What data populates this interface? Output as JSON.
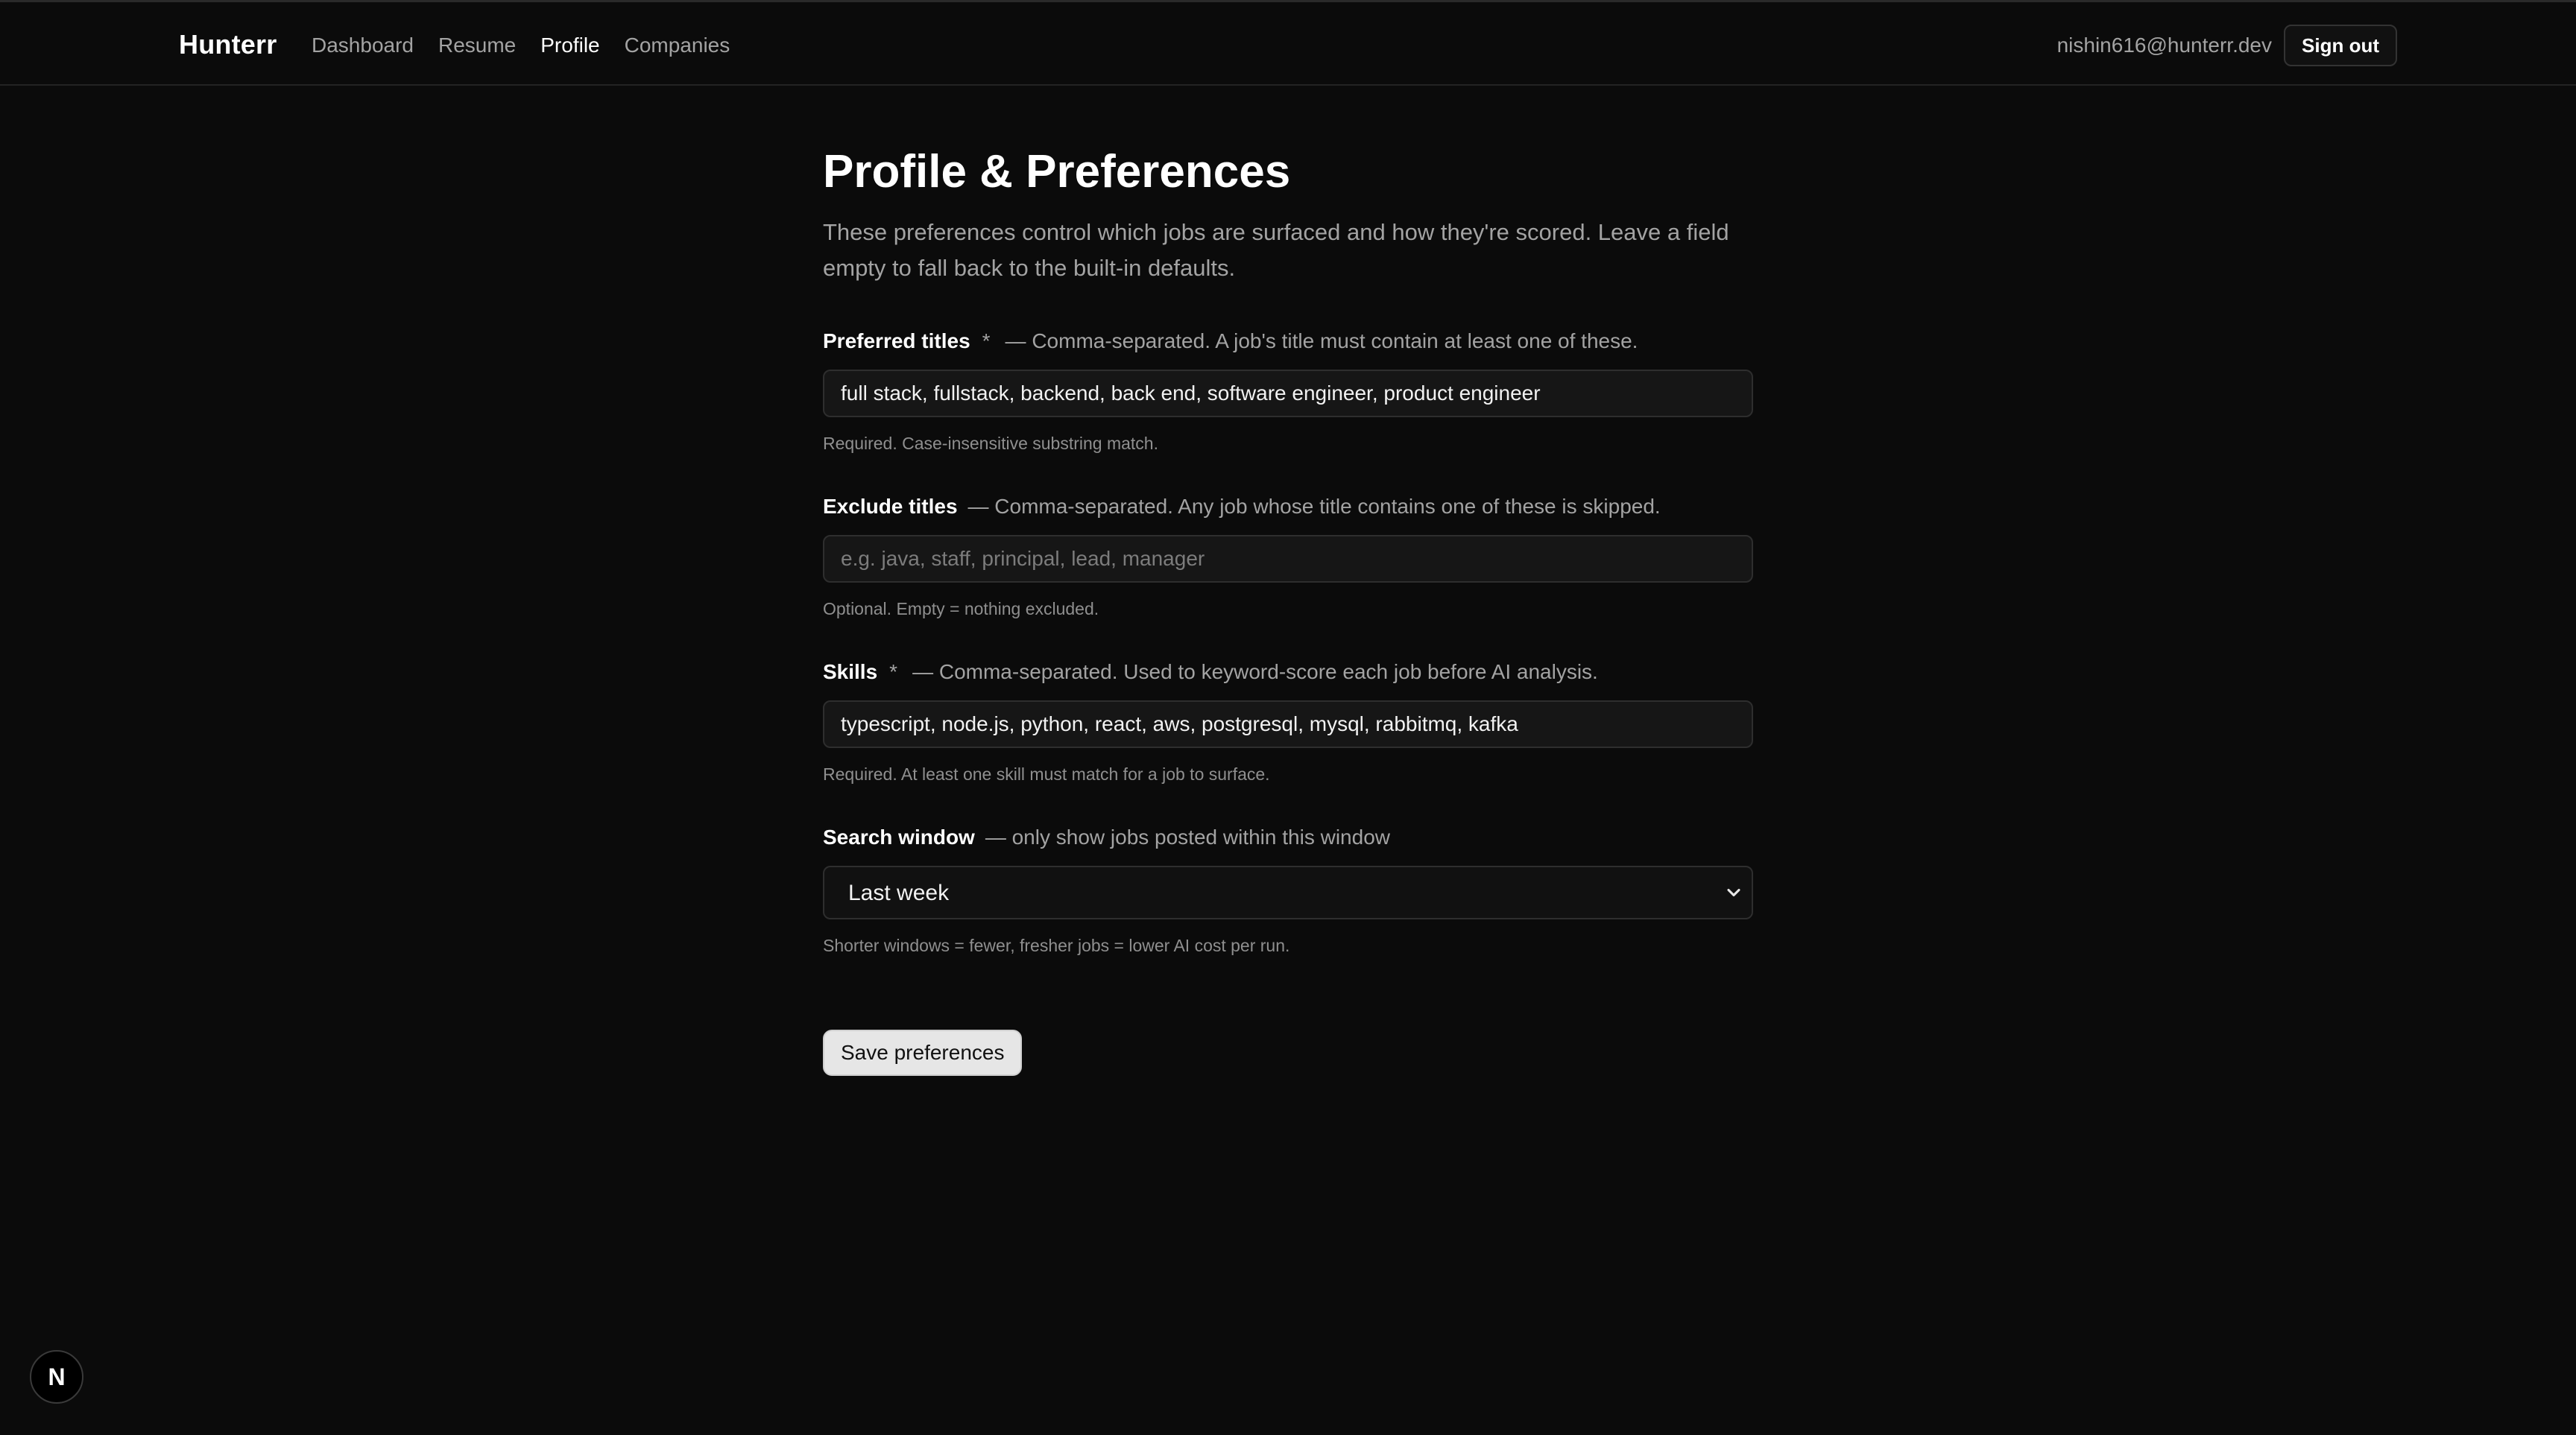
{
  "app": {
    "brand": "Hunterr",
    "nav": [
      {
        "label": "Dashboard",
        "active": false
      },
      {
        "label": "Resume",
        "active": false
      },
      {
        "label": "Profile",
        "active": true
      },
      {
        "label": "Companies",
        "active": false
      }
    ],
    "user_email": "nishin616@hunterr.dev",
    "sign_out_label": "Sign out"
  },
  "page": {
    "title": "Profile & Preferences",
    "subtitle": "These preferences control which jobs are surfaced and how they're scored. Leave a field empty to fall back to the built-in defaults."
  },
  "fields": {
    "preferred_titles": {
      "label": "Preferred titles",
      "required_mark": "*",
      "hint": "— Comma-separated. A job's title must contain at least one of these.",
      "value": "full stack, fullstack, backend, back end, software engineer, product engineer",
      "placeholder": "",
      "help": "Required. Case-insensitive substring match."
    },
    "exclude_titles": {
      "label": "Exclude titles",
      "hint": "— Comma-separated. Any job whose title contains one of these is skipped.",
      "value": "",
      "placeholder": "e.g. java, staff, principal, lead, manager",
      "help": "Optional. Empty = nothing excluded."
    },
    "skills": {
      "label": "Skills",
      "required_mark": "*",
      "hint": "— Comma-separated. Used to keyword-score each job before AI analysis.",
      "value": "typescript, node.js, python, react, aws, postgresql, mysql, rabbitmq, kafka",
      "placeholder": "",
      "help": "Required. At least one skill must match for a job to surface."
    },
    "search_window": {
      "label": "Search window",
      "hint": "— only show jobs posted within this window",
      "selected": "Last week",
      "help": "Shorter windows = fewer, fresher jobs = lower AI cost per run."
    }
  },
  "actions": {
    "save_label": "Save preferences"
  },
  "dev_badge": {
    "letter": "N"
  },
  "icons": {
    "select_chevron": "chevron-down-icon",
    "dev_badge": "nextjs-logo-icon"
  },
  "colors": {
    "background": "#0b0b0b",
    "text_primary": "#ffffff",
    "text_muted": "#a3a3a3",
    "input_bg": "#161616",
    "input_border": "#2e2e2e",
    "save_button_bg": "#e6e6e6"
  }
}
